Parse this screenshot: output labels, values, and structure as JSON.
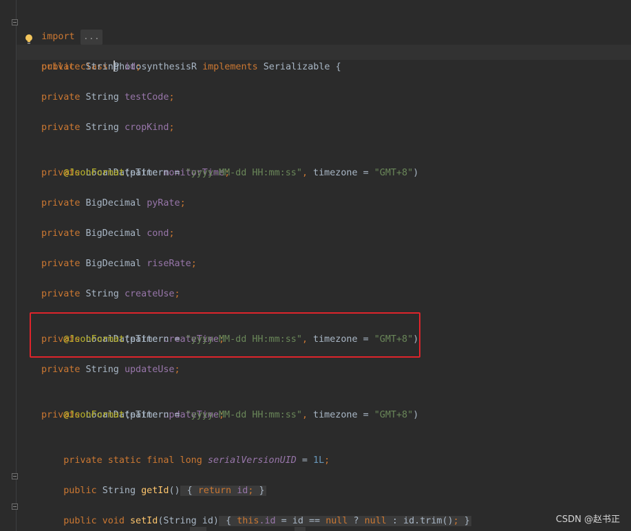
{
  "code": {
    "import_kw": "import",
    "import_fold": "...",
    "class_decl": {
      "kw1": "public",
      "kw2": "class",
      "name": "PhotosynthesisR",
      "kw3": "implements",
      "iface": "Serializable",
      "open": "{"
    },
    "fields": [
      {
        "type": "String",
        "name": "id"
      },
      {
        "type": "String",
        "name": "testCode"
      },
      {
        "type": "String",
        "name": "cropKind"
      },
      {
        "type": "LocalDateTime",
        "name": "monitorTime"
      },
      {
        "type": "BigDecimal",
        "name": "pyRate"
      },
      {
        "type": "BigDecimal",
        "name": "cond"
      },
      {
        "type": "BigDecimal",
        "name": "riseRate"
      },
      {
        "type": "String",
        "name": "createUse"
      },
      {
        "type": "LocalDateTime",
        "name": "createTime"
      },
      {
        "type": "String",
        "name": "updateUse"
      },
      {
        "type": "LocalDateTime",
        "name": "updateTime"
      }
    ],
    "private_kw": "private",
    "semicolon": ";",
    "annotation": {
      "name": "@JsonFormat",
      "open": "(pattern = ",
      "pattern": "\"yyyy-MM-dd HH:mm:ss\"",
      "comma": ",",
      "mid": " timezone = ",
      "tz": "\"GMT+8\"",
      "close": ")"
    },
    "serial": {
      "mods": "private static final long",
      "name": "serialVersionUID",
      "eq": " = ",
      "value": "1L"
    },
    "getter": {
      "mods": "public",
      "type": "String",
      "name": "getId",
      "parens": "()",
      "open": "{",
      "ret": "return",
      "field": "id",
      "close": "}"
    },
    "setter": {
      "mods": "public void",
      "name": "setId",
      "params": "(String id)",
      "open": "{",
      "this": "this",
      "dot_field": ".id",
      "rest1": " = id == ",
      "null1": "null",
      "rest2": " ? ",
      "null2": "null",
      "rest3": " : id.trim()",
      "close": "}"
    }
  },
  "watermark": "CSDN @赵书正",
  "colors": {
    "background": "#2b2b2b",
    "keyword": "#cc7832",
    "field": "#9876aa",
    "string": "#6a8759",
    "annotation": "#bbb529",
    "number": "#6897bb",
    "method": "#ffc66d",
    "highlight_box": "#e0242b"
  }
}
